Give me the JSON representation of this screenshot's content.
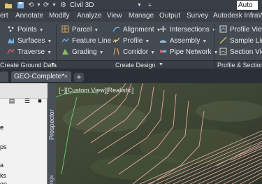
{
  "quick_access": {
    "workspace": "Civil 3D",
    "app_title": "Auto"
  },
  "ribbon_tabs": [
    "ert",
    "Annotate",
    "Modify",
    "Analyze",
    "View",
    "Manage",
    "Output",
    "Survey",
    "Autodesk InfraWor"
  ],
  "ribbon": {
    "create_ground_data": [
      "Points",
      "Surfaces",
      "Traverse"
    ],
    "create_design_col1": [
      "Parcel",
      "Feature Line",
      "Grading"
    ],
    "create_design_col2": [
      "Alignment",
      "Profile",
      "Corridor"
    ],
    "create_design_col3": [
      "Intersections",
      "Assembly",
      "Pipe Network"
    ],
    "profile_section": [
      "Profile View",
      "Sample Line",
      "Section View"
    ]
  },
  "panel_titles": {
    "ground": "Create Ground Data",
    "design": "Create Design",
    "profile_section": "Profile & Section Vi"
  },
  "document_tabs": {
    "active": "GEO-Complete*",
    "close": "×",
    "add": "+"
  },
  "toolspace": {
    "items": [
      "e",
      "ps",
      "a",
      "ks",
      "ge"
    ]
  },
  "prospector": {
    "label": "Prospector",
    "label2": "ngs"
  },
  "viewport": {
    "label": "[−][Custom View][Realistic]"
  },
  "colors": {
    "ribbon_bg": "#444a52",
    "contour": "#e8a8a0",
    "accent_blue": "#4aa0e6"
  }
}
